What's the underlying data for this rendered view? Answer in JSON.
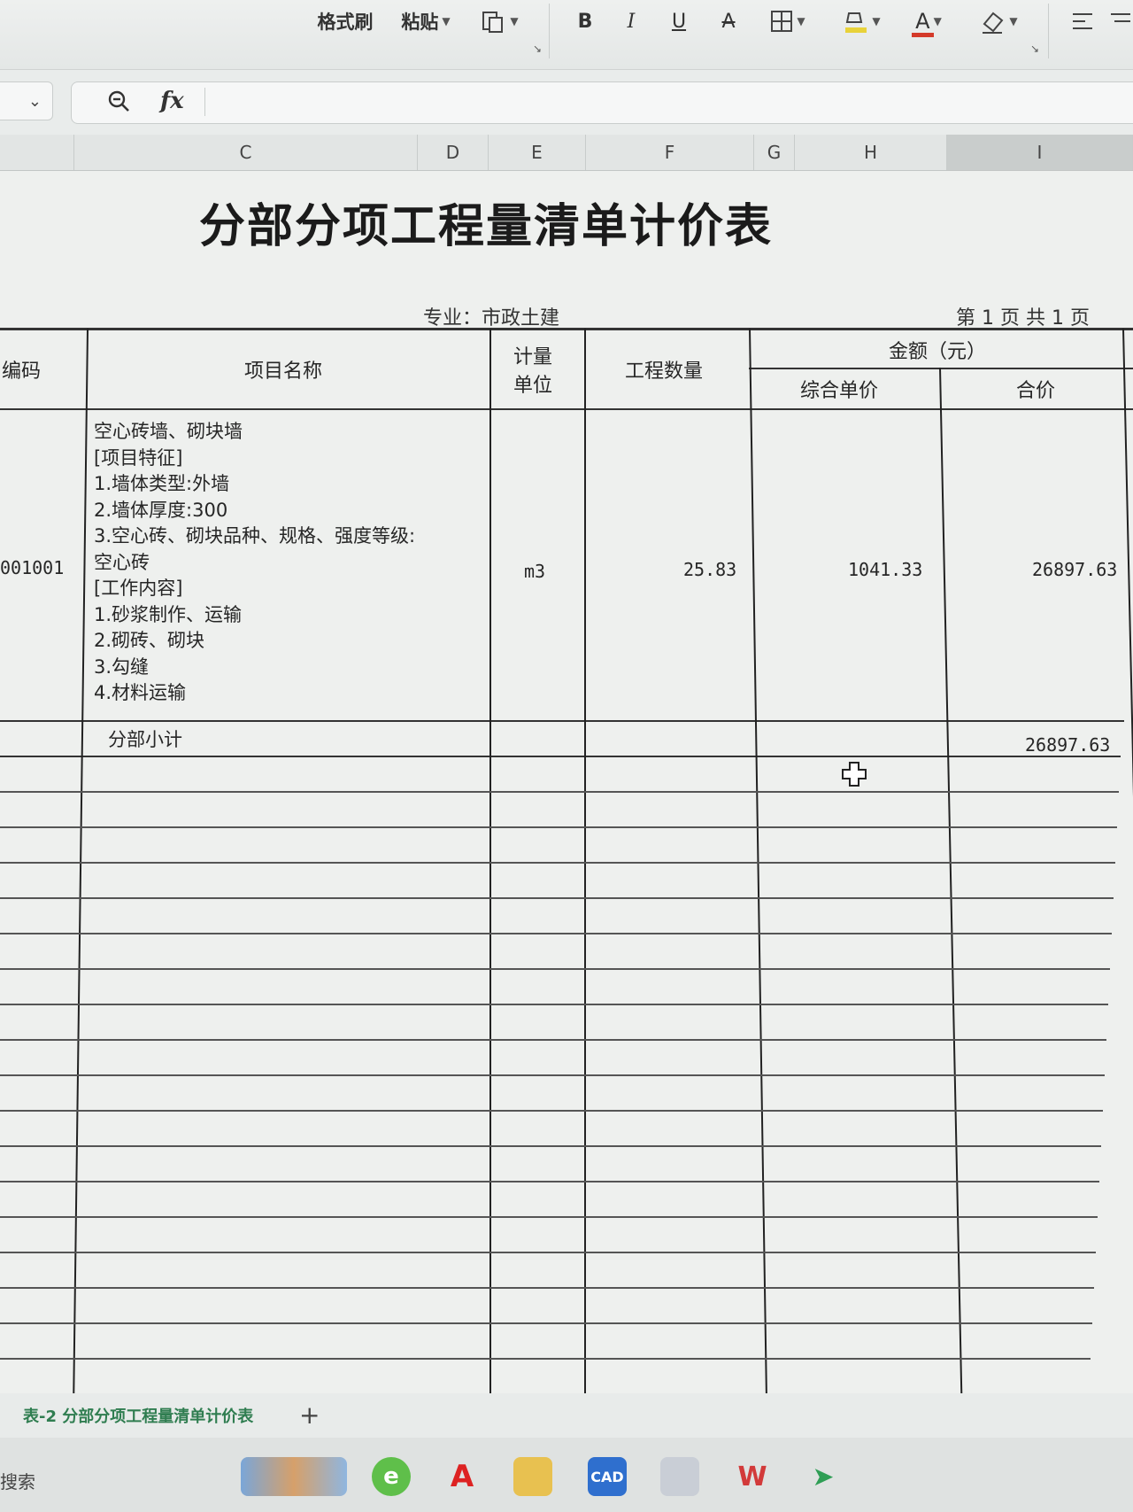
{
  "toolbar": {
    "format_painter": "格式刷",
    "paste": "粘贴",
    "bold": "B",
    "italic": "I",
    "underline": "U",
    "strike": "A",
    "font_color": "A",
    "font_color_hex": "#d43a2a",
    "highlight_hex": "#e8d23a"
  },
  "formula_bar": {
    "fx_label": "fx",
    "value": ""
  },
  "columns": [
    "C",
    "D",
    "E",
    "F",
    "G",
    "H",
    "I"
  ],
  "sheet": {
    "title": "分部分项工程量清单计价表",
    "specialty": "专业：市政土建",
    "page_info": "第 1 页  共 1 页",
    "headers": {
      "code": "编码",
      "name": "项目名称",
      "unit_line1": "计量",
      "unit_line2": "单位",
      "quantity": "工程数量",
      "amount": "金额（元）",
      "unit_price": "综合单价",
      "total": "合价"
    },
    "rows": [
      {
        "code": "001001",
        "name_lines": [
          "空心砖墙、砌块墙",
          "[项目特征]",
          "1.墙体类型:外墙",
          "2.墙体厚度:300",
          "3.空心砖、砌块品种、规格、强度等级:",
          "空心砖",
          "[工作内容]",
          "1.砂浆制作、运输",
          "2.砌砖、砌块",
          "3.勾缝",
          "4.材料运输"
        ],
        "unit": "m3",
        "quantity": "25.83",
        "unit_price": "1041.33",
        "total": "26897.63"
      }
    ],
    "subtotal": {
      "label": "分部小计",
      "total": "26897.63"
    }
  },
  "sheet_tabs": {
    "active": "表-2 分部分项工程量清单计价表",
    "add": "+"
  },
  "taskbar": {
    "search": "搜索"
  }
}
